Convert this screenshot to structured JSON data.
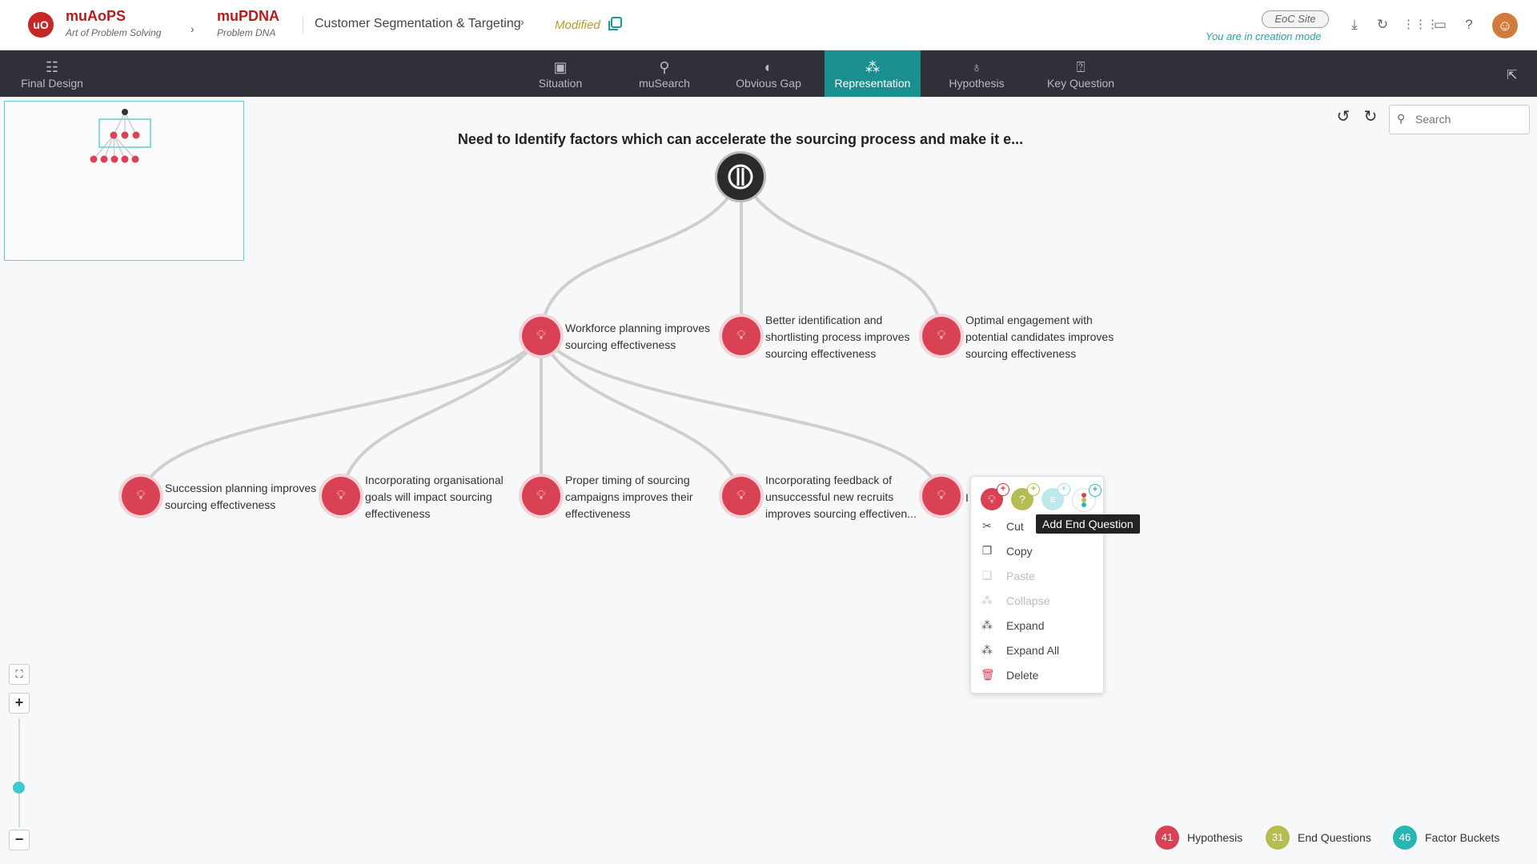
{
  "header": {
    "logo_text": "uO",
    "app1_title": "muAoPS",
    "app1_subtitle": "Art of Problem Solving",
    "app2_title": "muPDNA",
    "app2_subtitle": "Problem DNA",
    "breadcrumb": "Customer Segmentation & Targeting",
    "status": "Modified",
    "site_badge": "EoC Site",
    "mode_text": "You are in creation mode"
  },
  "nav": {
    "left_item": "Final Design",
    "tabs": [
      "Situation",
      "muSearch",
      "Obvious Gap",
      "Representation",
      "Hypothesis",
      "Key Question"
    ],
    "active_tab": "Representation"
  },
  "search": {
    "placeholder": "Search"
  },
  "tree": {
    "root_title": "Need to Identify factors which can accelerate the sourcing process and make it e...",
    "level1": [
      "Workforce planning improves sourcing effectiveness",
      "Better identification and shortlisting process improves sourcing effectiveness",
      "Optimal engagement with potential candidates improves sourcing effectiveness"
    ],
    "level2": [
      "Succession planning improves sourcing effectiveness",
      "Incorporating organisational goals will impact sourcing effectiveness",
      "Proper timing of sourcing campaigns improves their effectiveness",
      "Incorporating feedback of unsuccessful new recruits improves sourcing effectiven...",
      "I"
    ]
  },
  "context_menu": {
    "tooltip": "Add End Question",
    "items": [
      {
        "label": "Cut",
        "disabled": false
      },
      {
        "label": "Copy",
        "disabled": false
      },
      {
        "label": "Paste",
        "disabled": true
      },
      {
        "label": "Collapse",
        "disabled": true
      },
      {
        "label": "Expand",
        "disabled": false
      },
      {
        "label": "Expand All",
        "disabled": false
      },
      {
        "label": "Delete",
        "disabled": false
      }
    ]
  },
  "zoom": {
    "level_fraction": 0.37
  },
  "legend": [
    {
      "count": "41",
      "label": "Hypothesis",
      "color": "#d94155"
    },
    {
      "count": "31",
      "label": "End Questions",
      "color": "#b5bd52"
    },
    {
      "count": "46",
      "label": "Factor Buckets",
      "color": "#2ab5b5"
    }
  ],
  "colors": {
    "accent": "#1a8f8f",
    "node": "#d94155",
    "navbar": "#2f3038"
  }
}
